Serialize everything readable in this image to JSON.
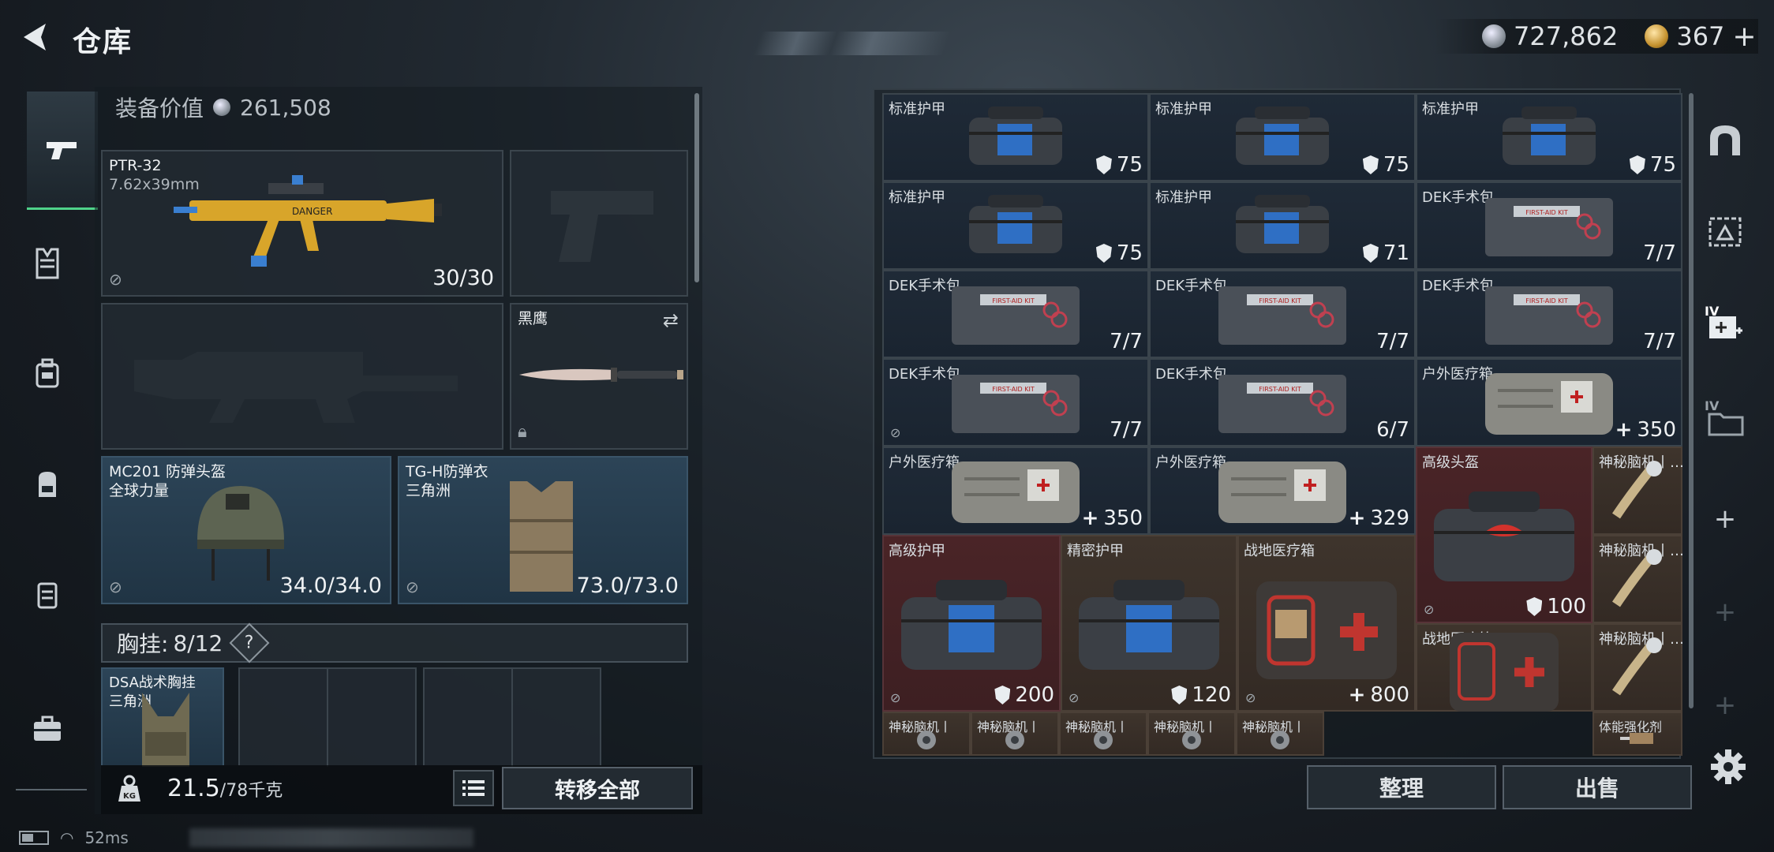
{
  "header": {
    "title": "仓库"
  },
  "currency": {
    "silver": "727,862",
    "gold": "367",
    "gold_plus": "+"
  },
  "left_nav": [
    "weapon-tab",
    "armor-tab",
    "helmet-tab",
    "backpack-tab",
    "vest-tab",
    "case-tab"
  ],
  "equipment": {
    "value_label": "装备价值",
    "value": "261,508",
    "primary": {
      "name": "PTR-32",
      "ammo_type": "7.62x39mm",
      "ammo": "30/30"
    },
    "melee": {
      "name": "黑鹰"
    },
    "helmet": {
      "name": "MC201 防弹头盔",
      "brand": "全球力量",
      "durability": "34.0/34.0"
    },
    "armor": {
      "name": "TG-H防弹衣",
      "brand": "三角洲",
      "durability": "73.0/73.0"
    },
    "chest_rig": {
      "label": "胸挂:",
      "capacity": "8/12",
      "help": "?",
      "item_name": "DSA战术胸挂",
      "item_brand": "三角洲"
    },
    "weight": {
      "current": "21.5",
      "max": "/78千克",
      "kg_label": "KG"
    },
    "transfer_all": "转移全部"
  },
  "stash": {
    "cells": [
      {
        "name": "标准护甲",
        "value": "75",
        "kind": "armor"
      },
      {
        "name": "标准护甲",
        "value": "75",
        "kind": "armor"
      },
      {
        "name": "标准护甲",
        "value": "75",
        "kind": "armor"
      },
      {
        "name": "标准护甲",
        "value": "75",
        "kind": "armor"
      },
      {
        "name": "标准护甲",
        "value": "71",
        "kind": "armor"
      },
      {
        "name": "DEK手术包",
        "value": "7/7",
        "kind": "count"
      },
      {
        "name": "DEK手术包",
        "value": "7/7",
        "kind": "count"
      },
      {
        "name": "DEK手术包",
        "value": "7/7",
        "kind": "count"
      },
      {
        "name": "DEK手术包",
        "value": "7/7",
        "kind": "count"
      },
      {
        "name": "DEK手术包",
        "value": "7/7",
        "kind": "count"
      },
      {
        "name": "DEK手术包",
        "value": "6/7",
        "kind": "count"
      },
      {
        "name": "户外医疗箱",
        "value": "350",
        "kind": "heal"
      },
      {
        "name": "户外医疗箱",
        "value": "350",
        "kind": "heal"
      },
      {
        "name": "户外医疗箱",
        "value": "329",
        "kind": "heal"
      },
      {
        "name": "高级头盔",
        "value": "100",
        "kind": "armor"
      },
      {
        "name": "神秘脑机丨…",
        "value": "",
        "kind": "none"
      },
      {
        "name": "神秘脑机丨…",
        "value": "",
        "kind": "none"
      },
      {
        "name": "高级护甲",
        "value": "200",
        "kind": "armor"
      },
      {
        "name": "精密护甲",
        "value": "120",
        "kind": "armor"
      },
      {
        "name": "战地医疗箱",
        "value": "800",
        "kind": "heal"
      },
      {
        "name": "战地医疗箱",
        "value": "",
        "kind": "none"
      },
      {
        "name": "神秘脑机丨…",
        "value": "",
        "kind": "none"
      },
      {
        "name": "神秘脑机丨",
        "value": "",
        "kind": "none"
      },
      {
        "name": "神秘脑机丨",
        "value": "",
        "kind": "none"
      },
      {
        "name": "神秘脑机丨",
        "value": "",
        "kind": "none"
      },
      {
        "name": "神秘脑机丨",
        "value": "",
        "kind": "none"
      },
      {
        "name": "神秘脑机丨",
        "value": "",
        "kind": "none"
      },
      {
        "name": "体能强化剂",
        "value": "",
        "kind": "none"
      }
    ],
    "sort_label": "整理",
    "sell_label": "出售"
  },
  "right_nav": {
    "tab_3_label": "IV",
    "tab_4_label": "IV",
    "add_1": "+",
    "add_2": "+",
    "add_3": "+"
  },
  "status_bar": {
    "ping": "52ms"
  },
  "colors": {
    "accent_green": "#4fd38a",
    "red_cell": "#4a2427",
    "blue_slot": "#2c4457"
  }
}
